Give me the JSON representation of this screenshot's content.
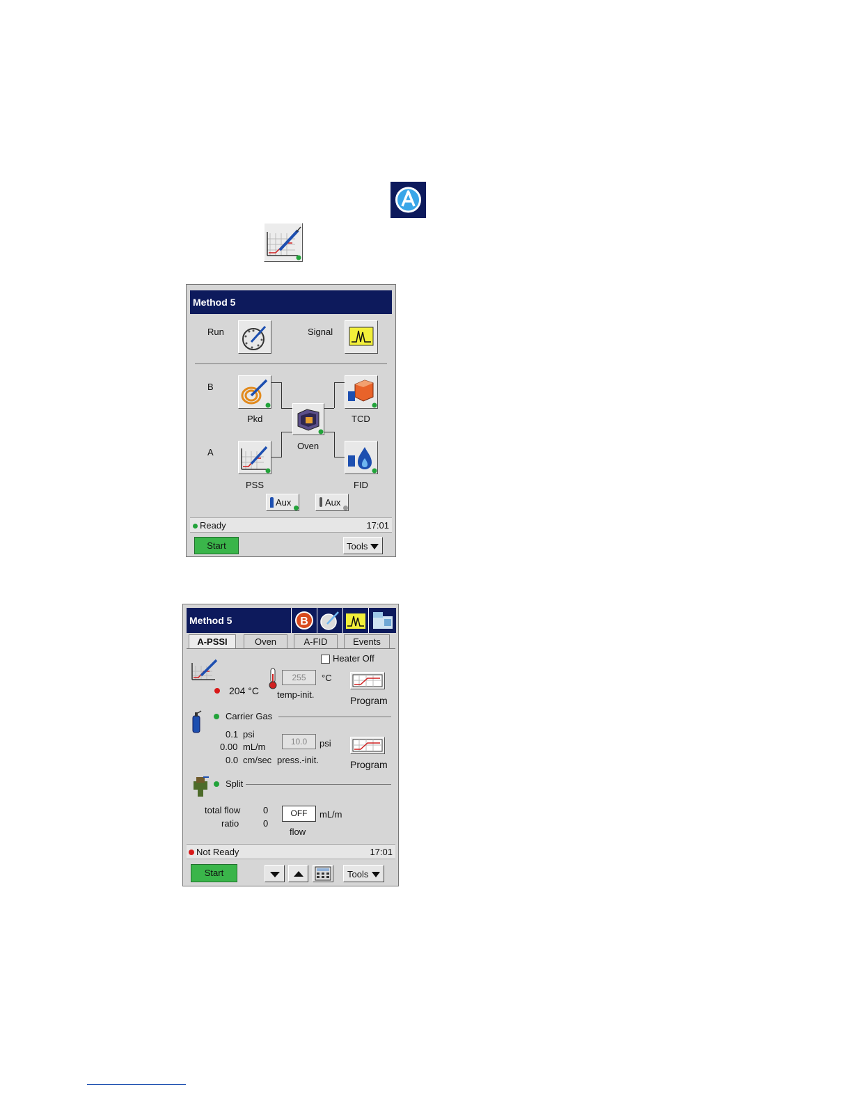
{
  "screen1": {
    "title": "Method 5",
    "run_label": "Run",
    "signal_label": "Signal",
    "channel_b": "B",
    "channel_a": "A",
    "pkd_label": "Pkd",
    "oven_label": "Oven",
    "tcd_label": "TCD",
    "pss_label": "PSS",
    "fid_label": "FID",
    "aux1_label": "Aux",
    "aux2_label": "Aux",
    "status_text": "Ready",
    "time": "17:01",
    "start_label": "Start",
    "tools_label": "Tools"
  },
  "screen2": {
    "title": "Method 5",
    "tabs": [
      "A-PSSI",
      "Oven",
      "A-FID",
      "Events"
    ],
    "heater_off_label": "Heater Off",
    "actual_temp": "204 °C",
    "temp_setpoint": "255",
    "temp_unit": "°C",
    "temp_caption": "temp-init.",
    "program_label_1": "Program",
    "carrier_gas_label": "Carrier Gas",
    "pressure_value": "0.1",
    "pressure_unit": "psi",
    "flow_value": "0.00",
    "flow_unit": "mL/m",
    "velocity_value": "0.0",
    "velocity_unit": "cm/sec",
    "press_setpoint": "10.0",
    "press_setpoint_unit": "psi",
    "press_caption": "press.-init.",
    "program_label_2": "Program",
    "split_label": "Split",
    "total_flow_label": "total flow",
    "total_flow_value": "0",
    "ratio_label": "ratio",
    "ratio_value": "0",
    "flow_field_value": "OFF",
    "flow_field_unit": "mL/m",
    "flow_caption": "flow",
    "status_text": "Not Ready",
    "time": "17:01",
    "start_label": "Start",
    "tools_label": "Tools"
  },
  "colors": {
    "title_bar": "#0d1a5c",
    "panel_bg": "#d6d6d6",
    "start_green": "#3ab54a",
    "ready_led": "#22a33a",
    "not_ready_led": "#d81818",
    "signal_yellow": "#f2ef3a"
  }
}
